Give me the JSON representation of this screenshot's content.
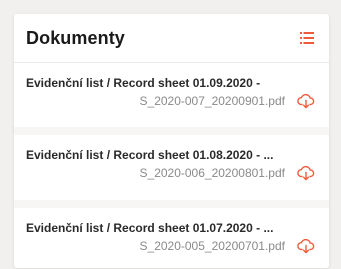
{
  "panel": {
    "title": "Dokumenty",
    "list_icon": "list-icon"
  },
  "documents": [
    {
      "title": "Evidenční list / Record sheet 01.09.2020 -",
      "file": "S_2020-007_20200901.pdf",
      "icon": "cloud-download-icon"
    },
    {
      "title": "Evidenční list / Record sheet 01.08.2020 - ...",
      "file": "S_2020-006_20200801.pdf",
      "icon": "cloud-download-icon"
    },
    {
      "title": "Evidenční list / Record sheet 01.07.2020 - ...",
      "file": "S_2020-005_20200701.pdf",
      "icon": "cloud-download-icon"
    }
  ],
  "colors": {
    "accent": "#ef5a3c",
    "background": "#f2f0ee",
    "panel": "#ffffff",
    "title_text": "#1a1a1a",
    "secondary_text": "#8a8a8a"
  }
}
